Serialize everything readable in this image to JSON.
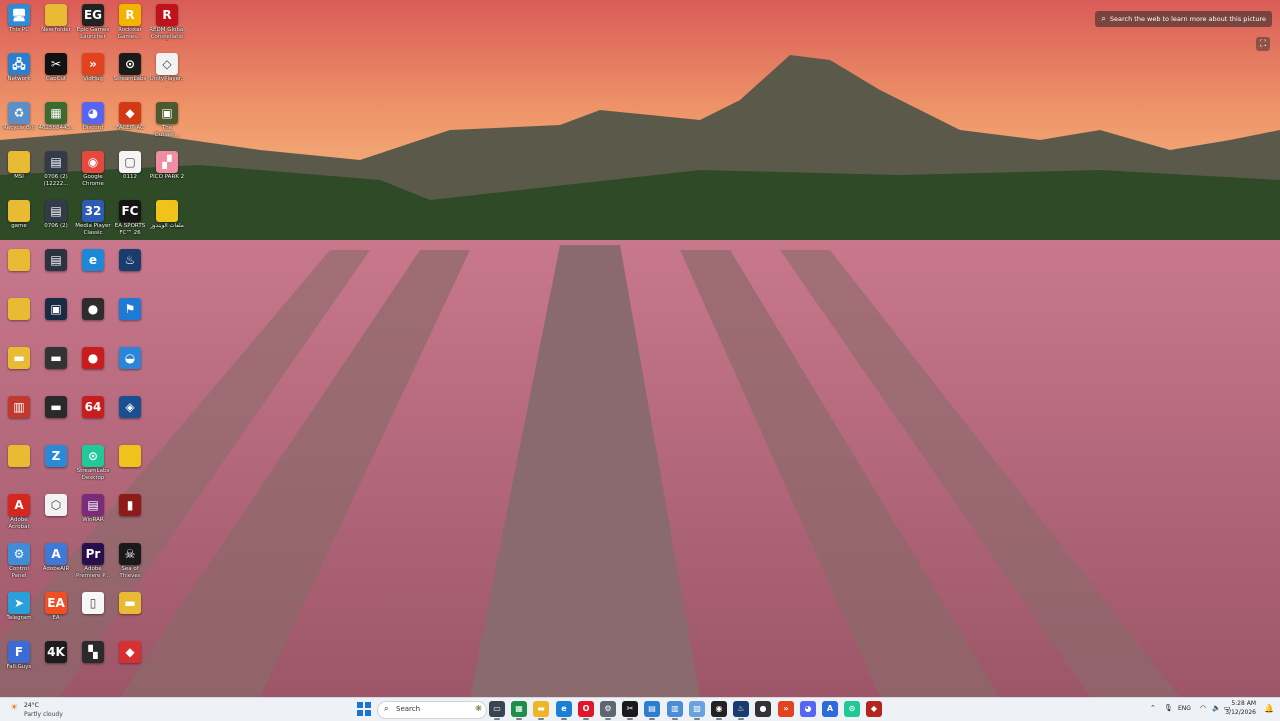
{
  "desktop": {
    "icons": [
      {
        "label": "This PC",
        "glyph": "🖥",
        "color": "#2e8bd6"
      },
      {
        "label": "New folder",
        "glyph": "",
        "color": "#e9bb34"
      },
      {
        "label": "Epic Games Launcher",
        "glyph": "EG",
        "color": "#222222"
      },
      {
        "label": "Rockstar Games...",
        "glyph": "R",
        "color": "#f2b400"
      },
      {
        "label": "REDM Global Constellation",
        "glyph": "R",
        "color": "#c0121c"
      },
      {
        "label": "Network",
        "glyph": "🖧",
        "color": "#2a7fd0"
      },
      {
        "label": "CapCut",
        "glyph": "✂",
        "color": "#111111"
      },
      {
        "label": "VidHug",
        "glyph": "»",
        "color": "#e3421e"
      },
      {
        "label": "StreamLabs",
        "glyph": "⊙",
        "color": "#1b1b1b"
      },
      {
        "label": "UnityPlayer...",
        "glyph": "◇",
        "color": "#f2f2f2"
      },
      {
        "label": "Recycle Bin",
        "glyph": "♻",
        "color": "#5a8fc7"
      },
      {
        "label": "462588443...",
        "glyph": "▦",
        "color": "#3c6a2f"
      },
      {
        "label": "Discord",
        "glyph": "◕",
        "color": "#5865f2"
      },
      {
        "label": "FACEIT AC",
        "glyph": "◆",
        "color": "#d23a16"
      },
      {
        "label": "The Outlast...",
        "glyph": "▣",
        "color": "#4d5a2e"
      },
      {
        "label": "MSI",
        "glyph": "",
        "color": "#e9bb34"
      },
      {
        "label": "0706 (2)(12222...",
        "glyph": "▤",
        "color": "#333a4a"
      },
      {
        "label": "Google Chrome",
        "glyph": "◉",
        "color": "#e5483c"
      },
      {
        "label": "0112",
        "glyph": "▢",
        "color": "#f5f5f5"
      },
      {
        "label": "PICO PARK 2",
        "glyph": "▞",
        "color": "#f28ca0"
      },
      {
        "label": "game",
        "glyph": "",
        "color": "#e9bb34"
      },
      {
        "label": "0706 (2)",
        "glyph": "▤",
        "color": "#333a4a"
      },
      {
        "label": "Media Player Classic",
        "glyph": "32",
        "color": "#2b5bb3"
      },
      {
        "label": "EA SPORTS FC™ 26",
        "glyph": "FC",
        "color": "#151515"
      },
      {
        "label": "ملفات الويندوز",
        "glyph": "",
        "color": "#f0c21c"
      },
      {
        "label": "",
        "glyph": "",
        "color": "#e9bb34"
      },
      {
        "label": "",
        "glyph": "▤",
        "color": "#2b3242"
      },
      {
        "label": "",
        "glyph": "e",
        "color": "#1e88d8"
      },
      {
        "label": "",
        "glyph": "♨",
        "color": "#1a3b6e"
      },
      {
        "label": "",
        "glyph": "",
        "color": "#e9bb34"
      },
      {
        "label": "",
        "glyph": "▣",
        "color": "#1a2b44"
      },
      {
        "label": "",
        "glyph": "●",
        "color": "#2d2d2d"
      },
      {
        "label": "",
        "glyph": "⚑",
        "color": "#1f7ad6"
      },
      {
        "label": "",
        "glyph": "▬",
        "color": "#e9bb34"
      },
      {
        "label": "",
        "glyph": "▬",
        "color": "#333333"
      },
      {
        "label": "",
        "glyph": "●",
        "color": "#c91c1c"
      },
      {
        "label": "",
        "glyph": "◒",
        "color": "#2a86d8"
      },
      {
        "label": "",
        "glyph": "▥",
        "color": "#c0392b"
      },
      {
        "label": "",
        "glyph": "▬",
        "color": "#2a2a2a"
      },
      {
        "label": "",
        "glyph": "64",
        "color": "#c91c1c"
      },
      {
        "label": "",
        "glyph": "◈",
        "color": "#1b4f8f"
      },
      {
        "label": "",
        "glyph": "",
        "color": "#e9bb34"
      },
      {
        "label": "",
        "glyph": "Z",
        "color": "#2b8ad8"
      },
      {
        "label": "StreamLabs Desktop",
        "glyph": "⊙",
        "color": "#20c997"
      },
      {
        "label": "",
        "glyph": "",
        "color": "#f0c21c"
      },
      {
        "label": "Adobe Acrobat",
        "glyph": "A",
        "color": "#d7261e"
      },
      {
        "label": "",
        "glyph": "⬡",
        "color": "#f2f2f2"
      },
      {
        "label": "WinRAR",
        "glyph": "▤",
        "color": "#7a2c7a"
      },
      {
        "label": "",
        "glyph": "▮",
        "color": "#8e1a1a"
      },
      {
        "label": "Control Panel",
        "glyph": "⚙",
        "color": "#3f8dd8"
      },
      {
        "label": "AdobeAIR",
        "glyph": "A",
        "color": "#3d79d8"
      },
      {
        "label": "Adobe Premiere P...",
        "glyph": "Pr",
        "color": "#2a0f4f"
      },
      {
        "label": "Sea of Thieves",
        "glyph": "☠",
        "color": "#1a1a1a"
      },
      {
        "label": "Telegram",
        "glyph": "➤",
        "color": "#2aa0da"
      },
      {
        "label": "EA",
        "glyph": "EA",
        "color": "#f04e23"
      },
      {
        "label": "",
        "glyph": "▯",
        "color": "#f7f7f7"
      },
      {
        "label": "",
        "glyph": "▬",
        "color": "#e9bb34"
      },
      {
        "label": "Fall Guys",
        "glyph": "F",
        "color": "#3c6bd6"
      },
      {
        "label": "",
        "glyph": "4K",
        "color": "#1d1d1d"
      },
      {
        "label": "",
        "glyph": "▚",
        "color": "#2a2a2a"
      },
      {
        "label": "",
        "glyph": "◆",
        "color": "#d63031"
      }
    ]
  },
  "visual_search": {
    "label": "Search the web to learn more about this picture",
    "icon": "camera-search-icon"
  },
  "taskbar": {
    "weather": {
      "temp": "24°C",
      "condition": "Partly cloudy",
      "icon": "sun-cloud-icon"
    },
    "search_placeholder": "Search",
    "apps": [
      {
        "name": "task-view",
        "glyph": "▭",
        "color": "#3b4350"
      },
      {
        "name": "widgets",
        "glyph": "▦",
        "color": "#1d8f4a"
      },
      {
        "name": "file-explorer",
        "glyph": "▬",
        "color": "#f0b429"
      },
      {
        "name": "edge",
        "glyph": "e",
        "color": "#1b7fd6"
      },
      {
        "name": "opera",
        "glyph": "O",
        "color": "#e0162b"
      },
      {
        "name": "settings",
        "glyph": "⚙",
        "color": "#5f6670"
      },
      {
        "name": "capcut",
        "glyph": "✂",
        "color": "#1b1b1b"
      },
      {
        "name": "calculator",
        "glyph": "▤",
        "color": "#2d7dd2"
      },
      {
        "name": "notepad",
        "glyph": "▥",
        "color": "#4b8bd8"
      },
      {
        "name": "photos",
        "glyph": "▨",
        "color": "#6aa2e0"
      },
      {
        "name": "obs",
        "glyph": "◉",
        "color": "#222222"
      },
      {
        "name": "steam",
        "glyph": "♨",
        "color": "#1a3b6e"
      },
      {
        "name": "media",
        "glyph": "●",
        "color": "#333333"
      },
      {
        "name": "vidhug",
        "glyph": "»",
        "color": "#e3421e"
      },
      {
        "name": "discord",
        "glyph": "◕",
        "color": "#5865f2"
      },
      {
        "name": "photoshop",
        "glyph": "A",
        "color": "#2f6bd8"
      },
      {
        "name": "streamlabs",
        "glyph": "⊙",
        "color": "#20c997"
      },
      {
        "name": "faceit",
        "glyph": "◆",
        "color": "#b3261e"
      }
    ],
    "tray": {
      "language": "ENG",
      "time": "5:28 AM",
      "date": "3/12/2026"
    }
  }
}
